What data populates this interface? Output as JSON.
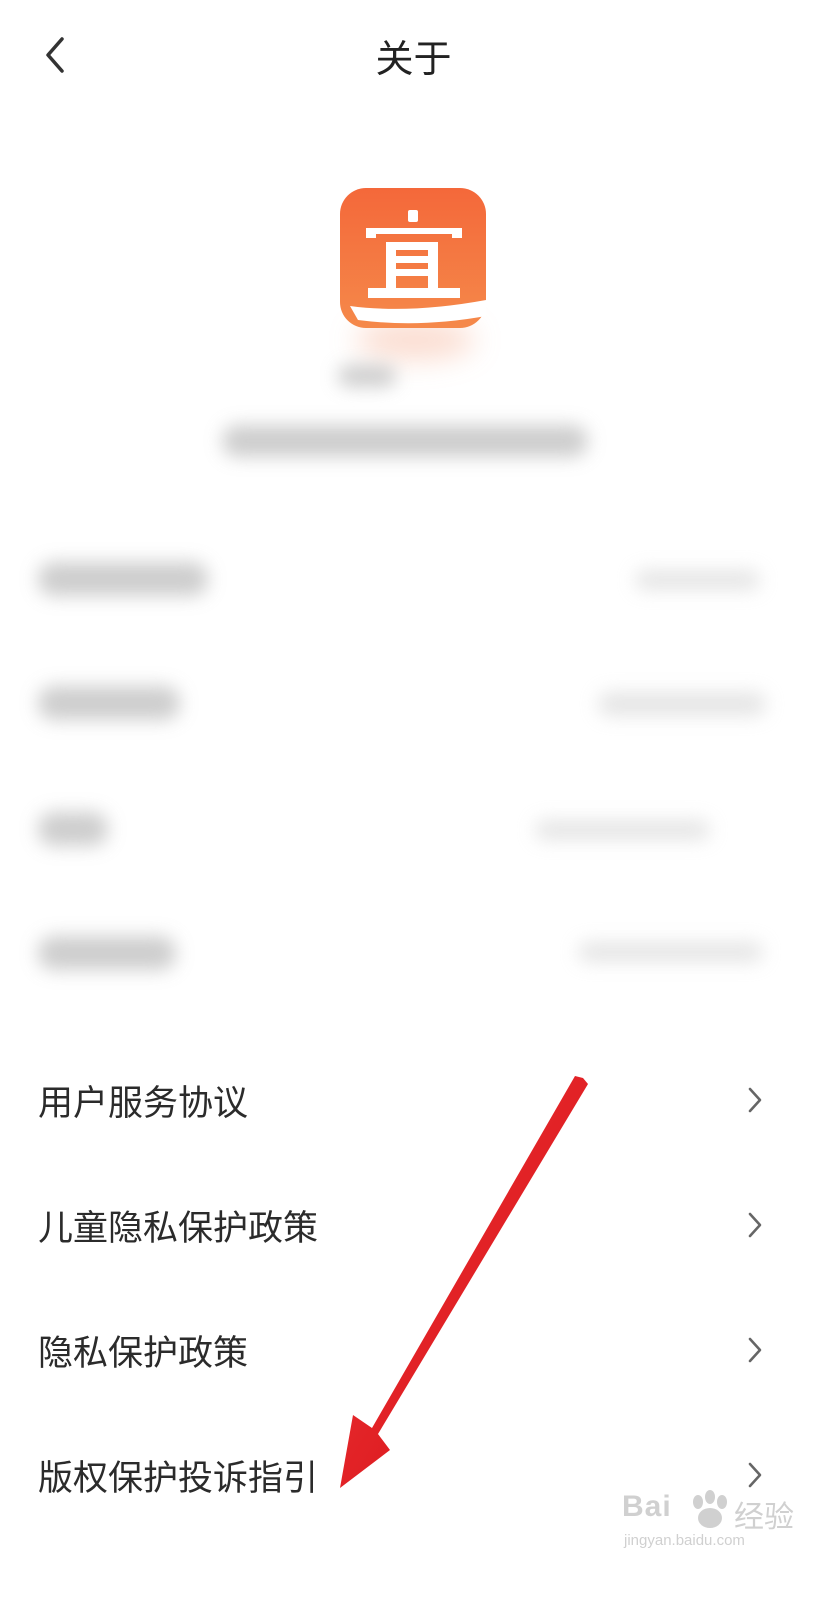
{
  "header": {
    "title": "关于",
    "back_icon": "chevron-left-icon"
  },
  "app": {
    "logo_icon": "app-logo-icon",
    "logo_glyph": "宜",
    "brand_colors": {
      "gradient_top": "#F56A3C",
      "gradient_bottom": "#F58A4A",
      "glyph": "#FFFFFF"
    }
  },
  "menu": {
    "items": [
      {
        "label": "用户服务协议",
        "icon": "chevron-right-icon"
      },
      {
        "label": "儿童隐私保护政策",
        "icon": "chevron-right-icon"
      },
      {
        "label": "隐私保护政策",
        "icon": "chevron-right-icon"
      },
      {
        "label": "版权保护投诉指引",
        "icon": "chevron-right-icon"
      }
    ]
  },
  "annotation": {
    "arrow_color": "#E8141B",
    "arrow_icon": "red-arrow-annotation"
  },
  "watermark": {
    "brand": "Bai",
    "suffix": "经验",
    "url": "jingyan.baidu.com"
  }
}
